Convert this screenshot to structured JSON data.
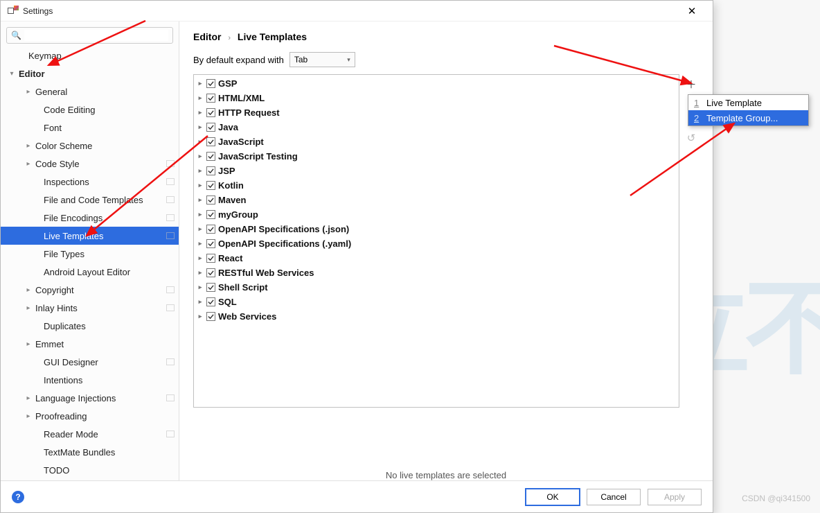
{
  "window": {
    "title": "Settings"
  },
  "search": {
    "placeholder": ""
  },
  "sidebar": {
    "items": [
      {
        "label": "Keymap",
        "indent": 24,
        "chev": "",
        "sq": false
      },
      {
        "label": "Editor",
        "indent": 10,
        "chev": "v",
        "bold": true,
        "sq": false
      },
      {
        "label": "General",
        "indent": 34,
        "chev": ">",
        "sq": false
      },
      {
        "label": "Code Editing",
        "indent": 46,
        "chev": "",
        "sq": false
      },
      {
        "label": "Font",
        "indent": 46,
        "chev": "",
        "sq": false
      },
      {
        "label": "Color Scheme",
        "indent": 34,
        "chev": ">",
        "sq": false
      },
      {
        "label": "Code Style",
        "indent": 34,
        "chev": ">",
        "sq": true
      },
      {
        "label": "Inspections",
        "indent": 46,
        "chev": "",
        "sq": true
      },
      {
        "label": "File and Code Templates",
        "indent": 46,
        "chev": "",
        "sq": true
      },
      {
        "label": "File Encodings",
        "indent": 46,
        "chev": "",
        "sq": true
      },
      {
        "label": "Live Templates",
        "indent": 46,
        "chev": "",
        "sq": true,
        "selected": true
      },
      {
        "label": "File Types",
        "indent": 46,
        "chev": "",
        "sq": false
      },
      {
        "label": "Android Layout Editor",
        "indent": 46,
        "chev": "",
        "sq": false
      },
      {
        "label": "Copyright",
        "indent": 34,
        "chev": ">",
        "sq": true
      },
      {
        "label": "Inlay Hints",
        "indent": 34,
        "chev": ">",
        "sq": true
      },
      {
        "label": "Duplicates",
        "indent": 46,
        "chev": "",
        "sq": false
      },
      {
        "label": "Emmet",
        "indent": 34,
        "chev": ">",
        "sq": false
      },
      {
        "label": "GUI Designer",
        "indent": 46,
        "chev": "",
        "sq": true
      },
      {
        "label": "Intentions",
        "indent": 46,
        "chev": "",
        "sq": false
      },
      {
        "label": "Language Injections",
        "indent": 34,
        "chev": ">",
        "sq": true
      },
      {
        "label": "Proofreading",
        "indent": 34,
        "chev": ">",
        "sq": false
      },
      {
        "label": "Reader Mode",
        "indent": 46,
        "chev": "",
        "sq": true
      },
      {
        "label": "TextMate Bundles",
        "indent": 46,
        "chev": "",
        "sq": false
      },
      {
        "label": "TODO",
        "indent": 46,
        "chev": "",
        "sq": false
      }
    ]
  },
  "breadcrumb": {
    "a": "Editor",
    "b": "Live Templates"
  },
  "expand": {
    "label": "By default expand with",
    "value": "Tab"
  },
  "template_groups": [
    "GSP",
    "HTML/XML",
    "HTTP Request",
    "Java",
    "JavaScript",
    "JavaScript Testing",
    "JSP",
    "Kotlin",
    "Maven",
    "myGroup",
    "OpenAPI Specifications (.json)",
    "OpenAPI Specifications (.yaml)",
    "React",
    "RESTful Web Services",
    "Shell Script",
    "SQL",
    "Web Services"
  ],
  "empty": "No live templates are selected",
  "buttons": {
    "ok": "OK",
    "cancel": "Cancel",
    "apply": "Apply"
  },
  "popup": {
    "items": [
      {
        "num": "1",
        "label": "Live Template",
        "sel": false
      },
      {
        "num": "2",
        "label": "Template Group...",
        "sel": true
      }
    ]
  },
  "watermark": "CSDN @qi341500"
}
